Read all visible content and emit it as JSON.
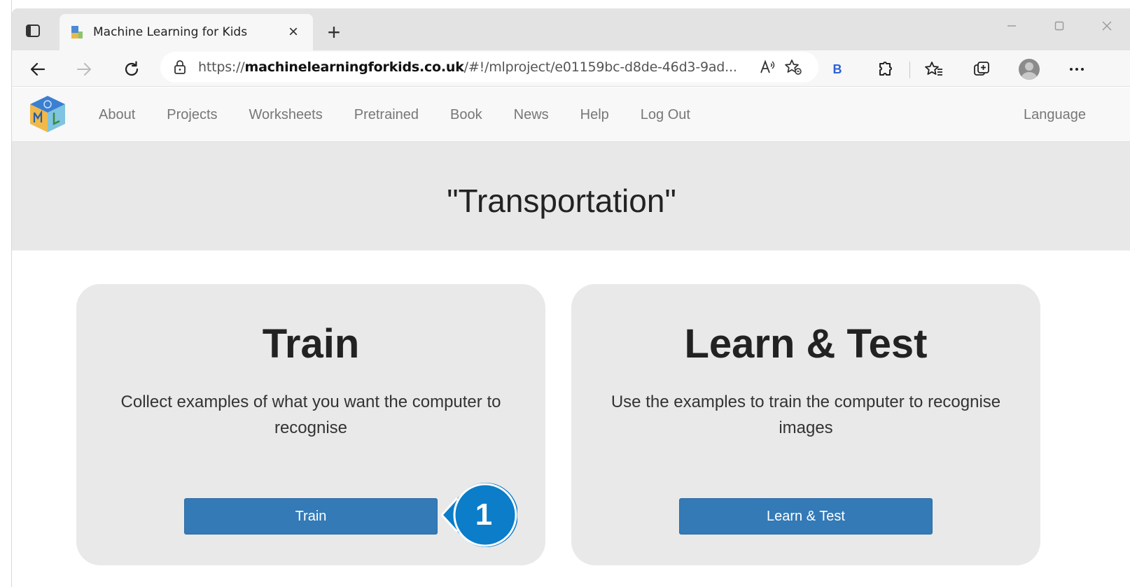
{
  "browser": {
    "tab_title": "Machine Learning for Kids",
    "url_prefix": "https://",
    "url_domain": "machinelearningforkids.co.uk",
    "url_path": "/#!/mlproject/e01159bc-d8de-46d3-9ad...",
    "bing_label": "B"
  },
  "site_nav": {
    "links": [
      "About",
      "Projects",
      "Worksheets",
      "Pretrained",
      "Book",
      "News",
      "Help",
      "Log Out"
    ],
    "language": "Language"
  },
  "project": {
    "title": "\"Transportation\""
  },
  "cards": {
    "train": {
      "heading": "Train",
      "description": "Collect examples of what you want the computer to recognise",
      "button": "Train"
    },
    "learn": {
      "heading": "Learn & Test",
      "description": "Use the examples to train the computer to recognise images",
      "button": "Learn & Test"
    }
  },
  "callout": {
    "number": "1",
    "color": "#0b7dc9"
  },
  "colors": {
    "button_blue": "#337ab7",
    "card_bg": "#e9e9e9",
    "band_bg": "#e8e8e8"
  }
}
